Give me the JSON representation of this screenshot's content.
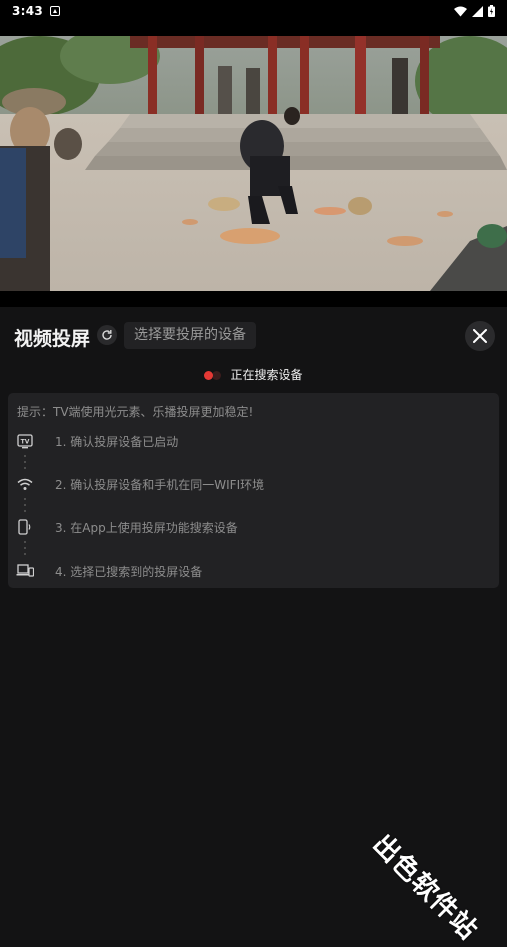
{
  "status_bar": {
    "time": "3:43"
  },
  "cast_panel": {
    "title": "视频投屏",
    "select_device_placeholder": "选择要投屏的设备",
    "searching_text": "正在搜索设备",
    "tips": {
      "hint": "提示：TV端使用光元素、乐播投屏更加稳定!",
      "steps": [
        {
          "icon": "tv-icon",
          "text": "1. 确认投屏设备已启动"
        },
        {
          "icon": "wifi-icon",
          "text": "2. 确认投屏设备和手机在同一WIFI环境"
        },
        {
          "icon": "phone-cast-icon",
          "text": "3. 在App上使用投屏功能搜索设备"
        },
        {
          "icon": "devices-icon",
          "text": "4. 选择已搜索到的投屏设备"
        }
      ]
    }
  },
  "watermark": "出色软件站",
  "colors": {
    "background": "#131314",
    "card": "#222224",
    "accent_red": "#e53935"
  }
}
